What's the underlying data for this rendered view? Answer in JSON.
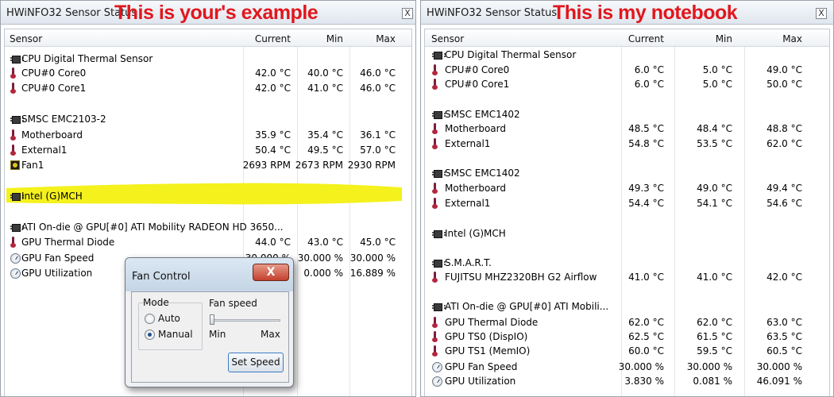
{
  "left": {
    "title": "HWiNFO32 Sensor Status",
    "annotation": "This is your's example",
    "close": "X",
    "headers": {
      "sensor": "Sensor",
      "current": "Current",
      "min": "Min",
      "max": "Max"
    },
    "rows": [
      {
        "icon": "chip",
        "name": "CPU Digital Thermal Sensor",
        "current": "",
        "min": "",
        "max": ""
      },
      {
        "icon": "therm",
        "name": "CPU#0 Core0",
        "current": "42.0 °C",
        "min": "40.0 °C",
        "max": "46.0 °C"
      },
      {
        "icon": "therm",
        "name": "CPU#0 Core1",
        "current": "42.0 °C",
        "min": "41.0 °C",
        "max": "46.0 °C"
      },
      {
        "icon": "chip",
        "name": "SMSC EMC2103-2",
        "current": "",
        "min": "",
        "max": ""
      },
      {
        "icon": "therm",
        "name": "Motherboard",
        "current": "35.9 °C",
        "min": "35.4 °C",
        "max": "36.1 °C"
      },
      {
        "icon": "therm",
        "name": "External1",
        "current": "50.4 °C",
        "min": "49.5 °C",
        "max": "57.0 °C"
      },
      {
        "icon": "fan",
        "name": "Fan1",
        "current": "2693 RPM",
        "min": "2673 RPM",
        "max": "2930 RPM"
      },
      {
        "icon": "chip",
        "name": "Intel (G)MCH",
        "current": "",
        "min": "",
        "max": ""
      },
      {
        "icon": "chip",
        "name": "ATI On-die @ GPU[#0] ATI Mobility RADEON HD 3650...",
        "current": "",
        "min": "",
        "max": ""
      },
      {
        "icon": "therm",
        "name": "GPU Thermal Diode",
        "current": "44.0 °C",
        "min": "43.0 °C",
        "max": "45.0 °C"
      },
      {
        "icon": "gauge",
        "name": "GPU Fan Speed",
        "current": "30.000 %",
        "min": "30.000 %",
        "max": "30.000 %"
      },
      {
        "icon": "gauge",
        "name": "GPU Utilization",
        "current": "",
        "min": "0.000 %",
        "max": "16.889 %"
      }
    ]
  },
  "right": {
    "title": "HWiNFO32 Sensor Status",
    "annotation": "This is my notebook",
    "close": "X",
    "headers": {
      "sensor": "Sensor",
      "current": "Current",
      "min": "Min",
      "max": "Max"
    },
    "rows": [
      {
        "icon": "chip",
        "name": "CPU Digital Thermal Sensor",
        "current": "",
        "min": "",
        "max": ""
      },
      {
        "icon": "therm",
        "name": "CPU#0 Core0",
        "current": "6.0 °C",
        "min": "5.0 °C",
        "max": "49.0 °C"
      },
      {
        "icon": "therm",
        "name": "CPU#0 Core1",
        "current": "6.0 °C",
        "min": "5.0 °C",
        "max": "50.0 °C"
      },
      {
        "icon": "chip",
        "name": "SMSC EMC1402",
        "current": "",
        "min": "",
        "max": ""
      },
      {
        "icon": "therm",
        "name": "Motherboard",
        "current": "48.5 °C",
        "min": "48.4 °C",
        "max": "48.8 °C"
      },
      {
        "icon": "therm",
        "name": "External1",
        "current": "54.8 °C",
        "min": "53.5 °C",
        "max": "62.0 °C"
      },
      {
        "icon": "chip",
        "name": "SMSC EMC1402",
        "current": "",
        "min": "",
        "max": ""
      },
      {
        "icon": "therm",
        "name": "Motherboard",
        "current": "49.3 °C",
        "min": "49.0 °C",
        "max": "49.4 °C"
      },
      {
        "icon": "therm",
        "name": "External1",
        "current": "54.4 °C",
        "min": "54.1 °C",
        "max": "54.6 °C"
      },
      {
        "icon": "chip",
        "name": "Intel (G)MCH",
        "current": "",
        "min": "",
        "max": ""
      },
      {
        "icon": "chip",
        "name": "S.M.A.R.T.",
        "current": "",
        "min": "",
        "max": ""
      },
      {
        "icon": "therm",
        "name": "FUJITSU MHZ2320BH G2 Airflow",
        "current": "41.0 °C",
        "min": "41.0 °C",
        "max": "42.0 °C"
      },
      {
        "icon": "chip",
        "name": "ATI On-die @ GPU[#0] ATI Mobili...",
        "current": "",
        "min": "",
        "max": ""
      },
      {
        "icon": "therm",
        "name": "GPU Thermal Diode",
        "current": "62.0 °C",
        "min": "62.0 °C",
        "max": "63.0 °C"
      },
      {
        "icon": "therm",
        "name": "GPU TS0 (DispIO)",
        "current": "62.5 °C",
        "min": "61.5 °C",
        "max": "63.5 °C"
      },
      {
        "icon": "therm",
        "name": "GPU TS1 (MemIO)",
        "current": "60.0 °C",
        "min": "59.5 °C",
        "max": "60.5 °C"
      },
      {
        "icon": "gauge",
        "name": "GPU Fan Speed",
        "current": "30.000 %",
        "min": "30.000 %",
        "max": "30.000 %"
      },
      {
        "icon": "gauge",
        "name": "GPU Utilization",
        "current": "3.830 %",
        "min": "0.081 %",
        "max": "46.091 %"
      }
    ]
  },
  "dialog": {
    "title": "Fan Control",
    "close": "X",
    "mode_label": "Mode",
    "auto_label": "Auto",
    "manual_label": "Manual",
    "selected_mode": "Manual",
    "fan_speed_label": "Fan speed",
    "slider_min_label": "Min",
    "slider_max_label": "Max",
    "slider_value": 0,
    "set_speed_label": "Set Speed"
  },
  "colors": {
    "annotation": "#e0171d",
    "highlight": "#f4f11d"
  }
}
